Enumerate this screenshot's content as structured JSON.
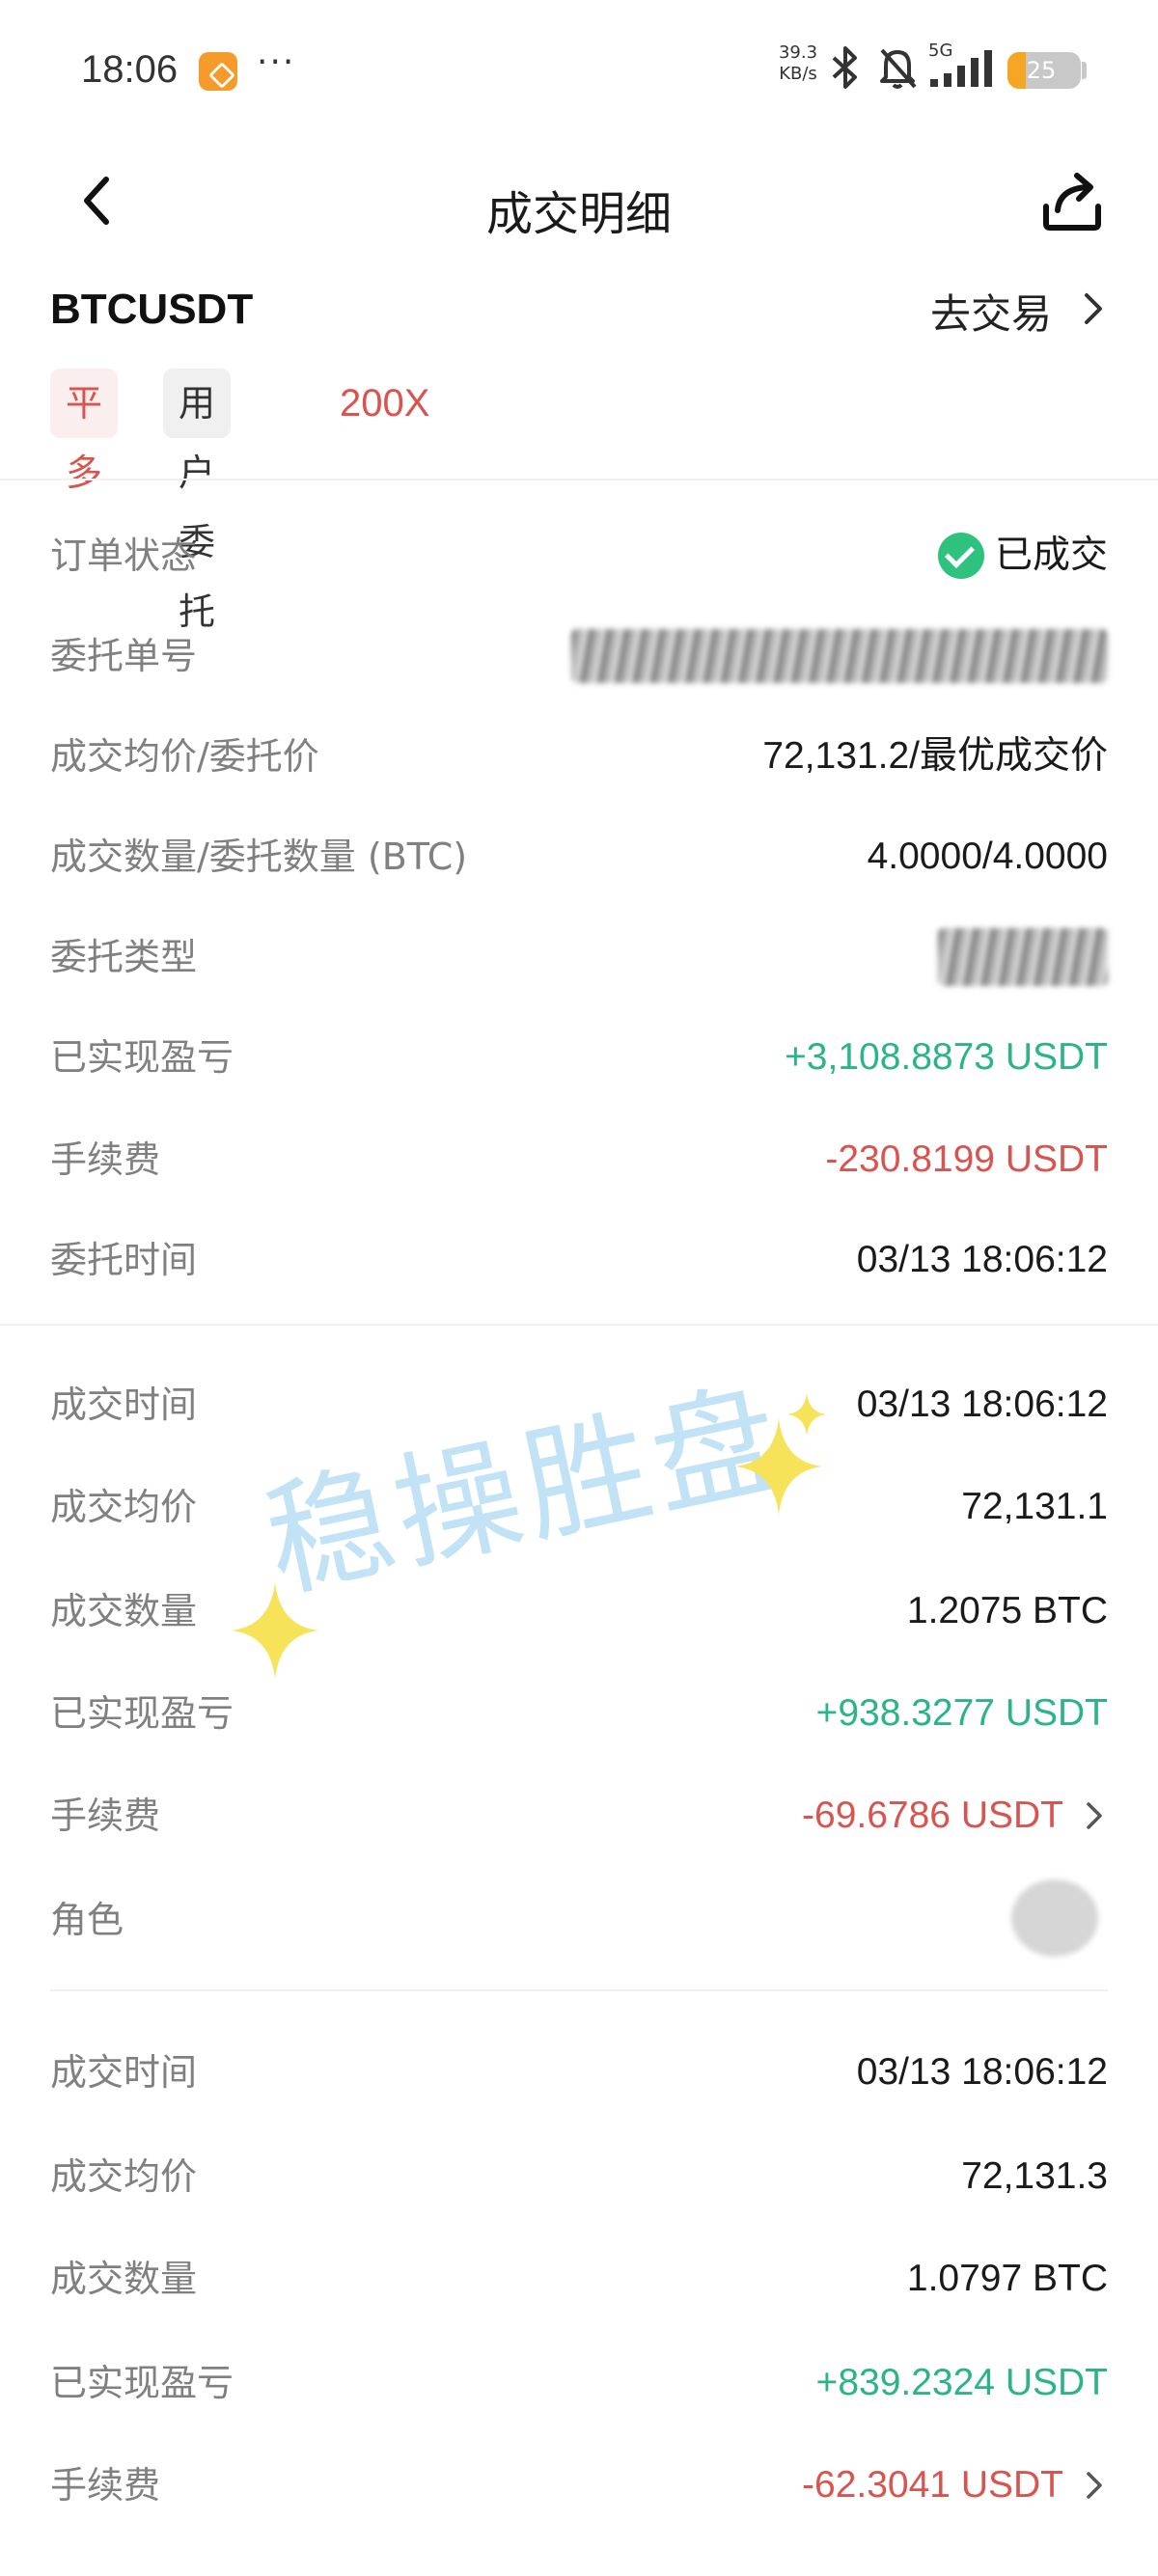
{
  "status_bar": {
    "time": "18:06",
    "more": "···",
    "net_speed_value": "39.3",
    "net_speed_unit": "KB/s",
    "network": "5G",
    "battery": "25",
    "battery_level": 0.25
  },
  "header": {
    "title": "成交明细"
  },
  "symbol_row": {
    "symbol": "BTCUSDT",
    "goto_trade": "去交易"
  },
  "tags": {
    "action": "平多",
    "order_source": "用户委托",
    "leverage": "200X"
  },
  "order_summary": [
    {
      "label": "订单状态",
      "value": "已成交"
    },
    {
      "label": "委托单号",
      "value": ""
    },
    {
      "label": "成交均价/委托价",
      "value": "72,131.2/最优成交价"
    },
    {
      "label": "成交数量/委托数量 (BTC)",
      "value": "4.0000/4.0000"
    },
    {
      "label": "委托类型",
      "value": ""
    },
    {
      "label": "已实现盈亏",
      "value": "+3,108.8873 USDT"
    },
    {
      "label": "手续费",
      "value": "-230.8199 USDT"
    },
    {
      "label": "委托时间",
      "value": "03/13 18:06:12"
    }
  ],
  "fills": [
    {
      "time_label": "成交时间",
      "time": "03/13 18:06:12",
      "price_label": "成交均价",
      "price": "72,131.1",
      "qty_label": "成交数量",
      "qty": "1.2075 BTC",
      "pnl_label": "已实现盈亏",
      "pnl": "+938.3277 USDT",
      "fee_label": "手续费",
      "fee": "-69.6786 USDT",
      "role_label": "角色",
      "role": ""
    },
    {
      "time_label": "成交时间",
      "time": "03/13 18:06:12",
      "price_label": "成交均价",
      "price": "72,131.3",
      "qty_label": "成交数量",
      "qty": "1.0797 BTC",
      "pnl_label": "已实现盈亏",
      "pnl": "+839.2324 USDT",
      "fee_label": "手续费",
      "fee": "-62.3041 USDT"
    }
  ],
  "watermark": "稳操胜盘",
  "colors": {
    "profit": "#2bb38a",
    "loss": "#d9534f",
    "label": "#808080"
  }
}
